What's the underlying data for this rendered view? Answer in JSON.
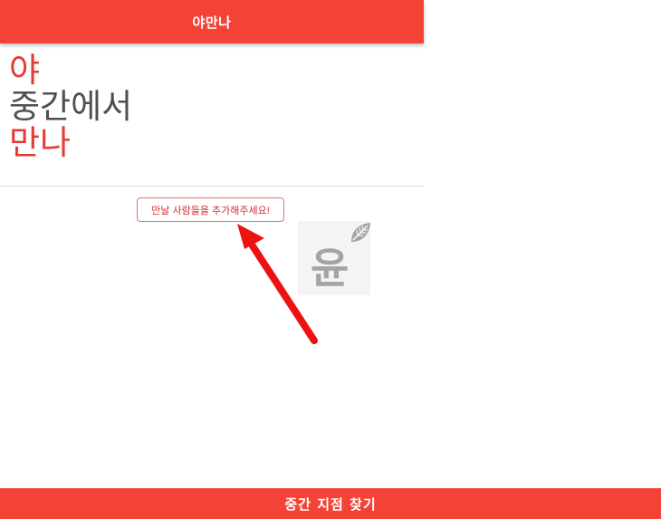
{
  "header": {
    "title": "야만나"
  },
  "hero": {
    "line1": "야",
    "line2": "중간에서",
    "line3": "만나"
  },
  "main": {
    "add_people_label": "만날 사람들을 추가해주세요!"
  },
  "watermark": {
    "text": "윤"
  },
  "footer": {
    "find_midpoint_label": "중간 지점 찾기"
  },
  "colors": {
    "primary": "#f44336",
    "accent_text": "#e53935",
    "body_text": "#4f4f4f",
    "annotation_arrow": "#ee1111"
  }
}
